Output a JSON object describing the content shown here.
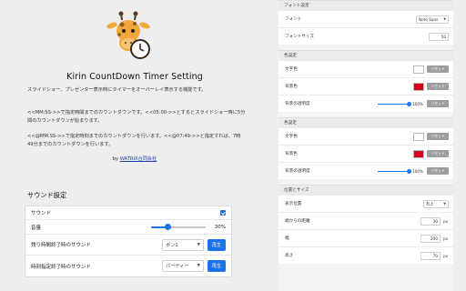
{
  "header": {
    "title": "Kirin CountDown Timer Setting"
  },
  "description": {
    "p1": "スライドショー、プレゼンター表示時にタイマーをオーバーレイ表示する機能です。",
    "p2": "<<MM:SS->>で指定時間までのカウントダウンです。<<05:00->>とするとスライドショー時に5分間のカウントダウンが始まります。",
    "p3": "<<@MM:SS->>で指定時刻までのカウントダウンを行います。<<@07:49->>と指定すれば、7時49分までのカウントダウンを行います。",
    "by_prefix": "by ",
    "company": "WATRIX合同会社"
  },
  "sound": {
    "section_title": "サウンド設定",
    "enable_label": "サウンド",
    "enabled": true,
    "volume_label": "音量",
    "volume_value": 30,
    "volume_text": "30%",
    "remaining_label": "残り時間終了時のサウンド",
    "remaining_option": "ポン1",
    "specified_label": "時刻指定終了時のサウンド",
    "specified_option": "パーティー",
    "play_label": "再生"
  },
  "font_settings": {
    "header": "フォント設定",
    "font_label": "フォント",
    "font_value": "Noto Sans",
    "size_label": "フォントサイズ",
    "size_value": "50"
  },
  "color_settings_1": {
    "header": "色設定",
    "text_color_label": "文字色",
    "text_color": "#ffffff",
    "bg_color_label": "背景色",
    "bg_color": "#d0021b",
    "opacity_label": "背景の透明度",
    "opacity_value": 100,
    "opacity_text": "100%",
    "reset_label": "リセット"
  },
  "color_settings_2": {
    "header": "色設定",
    "text_color_label": "文字色",
    "text_color": "#ffffff",
    "bg_color_label": "背景色",
    "bg_color": "#d0021b",
    "opacity_label": "背景の透明度",
    "opacity_value": 100,
    "opacity_text": "100%",
    "reset_label": "リセット"
  },
  "position_settings": {
    "header": "位置とサイズ",
    "position_label": "表示位置",
    "position_value": "右上",
    "margin_label": "端からの距離",
    "margin_value": "30",
    "width_label": "幅",
    "width_value": "200",
    "height_label": "高さ",
    "height_value": "70",
    "unit": "px"
  },
  "colors": {
    "accent": "#1a73e8",
    "reset_button": "#9e9e9e",
    "link": "#1a3fb5"
  },
  "icons": {
    "logo": "giraffe-clock-logo",
    "dropdown": "chevron-down-icon",
    "checkbox": "check-icon"
  }
}
